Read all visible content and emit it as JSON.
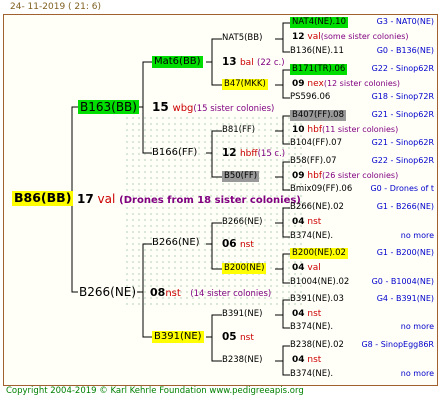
{
  "date_text": "24- 11-2019 ( 21: 6)",
  "footer": "Copyright 2004-2019 © Karl Kehrle Foundation    www.pedigreeapis.org",
  "colors": {
    "yellow": "#ffff00",
    "green": "#00dd00",
    "grey": "#999999",
    "red": "#cc0000",
    "blue": "#0000cc"
  },
  "root": {
    "label": "B86(BB)",
    "num": "17",
    "word": "val",
    "note": "(Drones from 18 sister colonies)"
  },
  "gen1": [
    {
      "label": "B163(BB)",
      "num": "15",
      "word": "wbg",
      "note": "(15 sister colonies)"
    },
    {
      "label": "B266(NE)",
      "num": "08",
      "word": "nst",
      "note": "(14 sister colonies)"
    }
  ],
  "gen2": [
    {
      "label": "Mat6(BB)",
      "num": "13",
      "word": "bal",
      "note": "(22 c.)"
    },
    {
      "label": "B166(FF)",
      "num": "12",
      "word": "hbff",
      "note": "(15 c.)"
    },
    {
      "label": "B266(NE)",
      "num": "06",
      "word": "nst",
      "note": ""
    },
    {
      "label": "B391(NE)",
      "num": "05",
      "word": "nst",
      "note": ""
    }
  ],
  "gen3": [
    {
      "label": "NAT5(BB)",
      "num": "12",
      "word": "val",
      "note": "(some sister colonies)"
    },
    {
      "label": "B47(MKK)",
      "num": "09",
      "word": "nex",
      "note": "(12 sister colonies)"
    },
    {
      "label": "B81(FF)",
      "num": "10",
      "word": "hbf",
      "note": "(11 sister colonies)"
    },
    {
      "label": "B50(FF)",
      "num": "09",
      "word": "hbf",
      "note": "(26 sister colonies)"
    },
    {
      "label": "B266(NE)",
      "num": "04",
      "word": "nst",
      "note": ""
    },
    {
      "label": "B200(NE)",
      "num": "04",
      "word": "val",
      "note": ""
    },
    {
      "label": "B391(NE)",
      "num": "04",
      "word": "nst",
      "note": ""
    },
    {
      "label": "B238(NE)",
      "num": "04",
      "word": "nst",
      "note": ""
    }
  ],
  "gen4": [
    {
      "label": "NAT4(NE).10",
      "info": "G3 - NAT0(NE)"
    },
    {
      "label": "B136(NE).11",
      "info": "G0 - B136(NE)"
    },
    {
      "label": "B171(TR).06",
      "info": "G22 - Sinop62R"
    },
    {
      "label": "PS596.06",
      "info": "G18 - Sinop72R"
    },
    {
      "label": "B407(FF).08",
      "info": "G21 - Sinop62R"
    },
    {
      "label": "B104(FF).07",
      "info": "G21 - Sinop62R"
    },
    {
      "label": "B58(FF).07",
      "info": "G22 - Sinop62R"
    },
    {
      "label": "Bmix09(FF).06",
      "info": "G0 - Drones of t"
    },
    {
      "label": "B266(NE).02",
      "info": "G1 - B266(NE)"
    },
    {
      "label": "B374(NE).",
      "info": "no more"
    },
    {
      "label": "B200(NE).02",
      "info": "G1 - B200(NE)"
    },
    {
      "label": "B1004(NE).02",
      "info": "G0 - B1004(NE)"
    },
    {
      "label": "B391(NE).03",
      "info": "G4 - B391(NE)"
    },
    {
      "label": "B374(NE).",
      "info": "no more"
    },
    {
      "label": "B238(NE).02",
      "info": "G8 - SinopEgg86R"
    },
    {
      "label": "B374(NE).",
      "info": "no more"
    }
  ]
}
